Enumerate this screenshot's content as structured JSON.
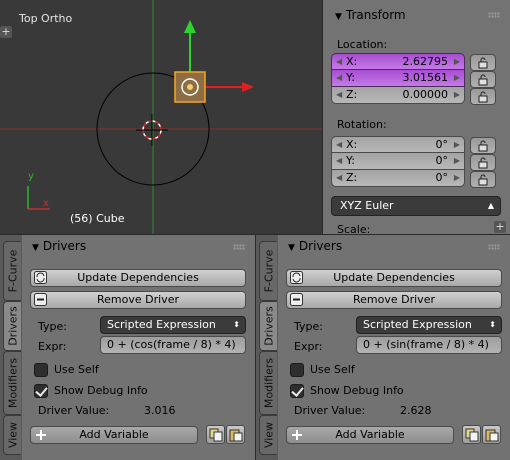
{
  "viewport": {
    "title": "Top Ortho",
    "object_label": "(56) Cube",
    "axis_y": "y",
    "axis_x": "x",
    "colors": {
      "background": "#393939",
      "y_axis": "#2ea12e",
      "x_axis": "#a03232",
      "selected": "#f5a623"
    }
  },
  "transform": {
    "title": "Transform",
    "location_label": "Location:",
    "location": [
      {
        "axis": "X:",
        "value": "2.62795",
        "animated": true
      },
      {
        "axis": "Y:",
        "value": "3.01561",
        "animated": true
      },
      {
        "axis": "Z:",
        "value": "0.00000",
        "animated": false
      }
    ],
    "rotation_label": "Rotation:",
    "rotation": [
      {
        "axis": "X:",
        "value": "0°"
      },
      {
        "axis": "Y:",
        "value": "0°"
      },
      {
        "axis": "Z:",
        "value": "0°"
      }
    ],
    "rotation_mode": "XYZ Euler",
    "scale_label": "Scale:",
    "animated_color": "#b562dc"
  },
  "tabs": [
    "F-Curve",
    "Drivers",
    "Modifiers",
    "View"
  ],
  "editors": [
    {
      "panel_title": "Drivers",
      "update_label": "Update Dependencies",
      "remove_label": "Remove Driver",
      "type_label": "Type:",
      "type_value": "Scripted Expression",
      "expr_label": "Expr:",
      "expr_value": "0 + (cos(frame / 8) * 4)",
      "use_self_label": "Use Self",
      "use_self": false,
      "debug_label": "Show Debug Info",
      "debug": true,
      "driver_value_label": "Driver Value:",
      "driver_value": "3.016",
      "add_variable_label": "Add Variable"
    },
    {
      "panel_title": "Drivers",
      "update_label": "Update Dependencies",
      "remove_label": "Remove Driver",
      "type_label": "Type:",
      "type_value": "Scripted Expression",
      "expr_label": "Expr:",
      "expr_value": "0 + (sin(frame / 8) * 4)",
      "use_self_label": "Use Self",
      "use_self": false,
      "debug_label": "Show Debug Info",
      "debug": true,
      "driver_value_label": "Driver Value:",
      "driver_value": "2.628",
      "add_variable_label": "Add Variable"
    }
  ]
}
